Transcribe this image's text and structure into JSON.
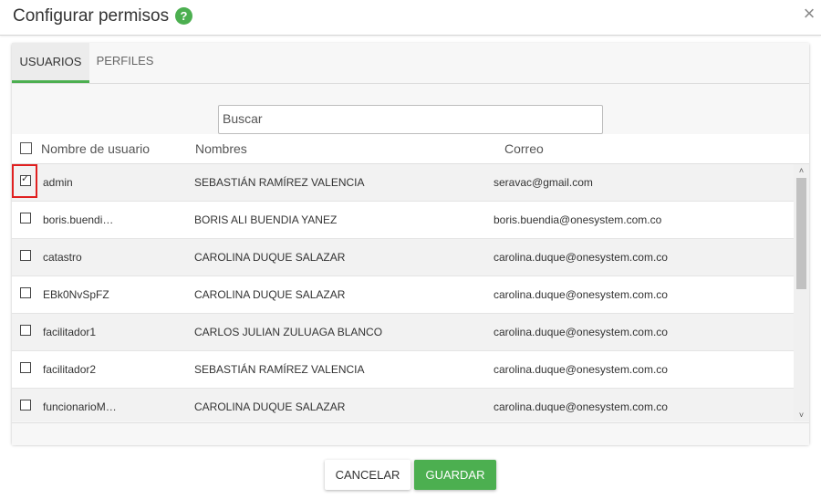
{
  "dialog": {
    "title": "Configurar permisos",
    "help_icon": "question-circle-icon",
    "help_symbol": "?",
    "close_icon": "close-icon",
    "close_symbol": "×"
  },
  "tabs": [
    {
      "label": "USUARIOS",
      "active": true
    },
    {
      "label": "PERFILES",
      "active": false
    }
  ],
  "search": {
    "placeholder": "Buscar",
    "value": ""
  },
  "table": {
    "columns": [
      "Nombre de usuario",
      "Nombres",
      "Correo"
    ],
    "rows": [
      {
        "username": "admin",
        "name": "SEBASTIÁN RAMÍREZ VALENCIA",
        "email": "seravac@gmail.com",
        "checked": true
      },
      {
        "username": "boris.buendi…",
        "name": "BORIS ALI BUENDIA YANEZ",
        "email": "boris.buendia@onesystem.com.co",
        "checked": false
      },
      {
        "username": "catastro",
        "name": "CAROLINA DUQUE SALAZAR",
        "email": "carolina.duque@onesystem.com.co",
        "checked": false
      },
      {
        "username": "EBk0NvSpFZ",
        "name": "CAROLINA DUQUE SALAZAR",
        "email": "carolina.duque@onesystem.com.co",
        "checked": false
      },
      {
        "username": "facilitador1",
        "name": "CARLOS JULIAN ZULUAGA BLANCO",
        "email": "carolina.duque@onesystem.com.co",
        "checked": false
      },
      {
        "username": "facilitador2",
        "name": "SEBASTIÁN RAMÍREZ VALENCIA",
        "email": "carolina.duque@onesystem.com.co",
        "checked": false
      },
      {
        "username": "funcionarioM…",
        "name": "CAROLINA DUQUE SALAZAR",
        "email": "carolina.duque@onesystem.com.co",
        "checked": false
      }
    ]
  },
  "scrollbar": {
    "up_symbol": "˄",
    "down_symbol": "˅"
  },
  "buttons": {
    "cancel": "CANCELAR",
    "save": "GUARDAR"
  },
  "colors": {
    "accent": "#4caf50",
    "highlight": "#e02020"
  }
}
